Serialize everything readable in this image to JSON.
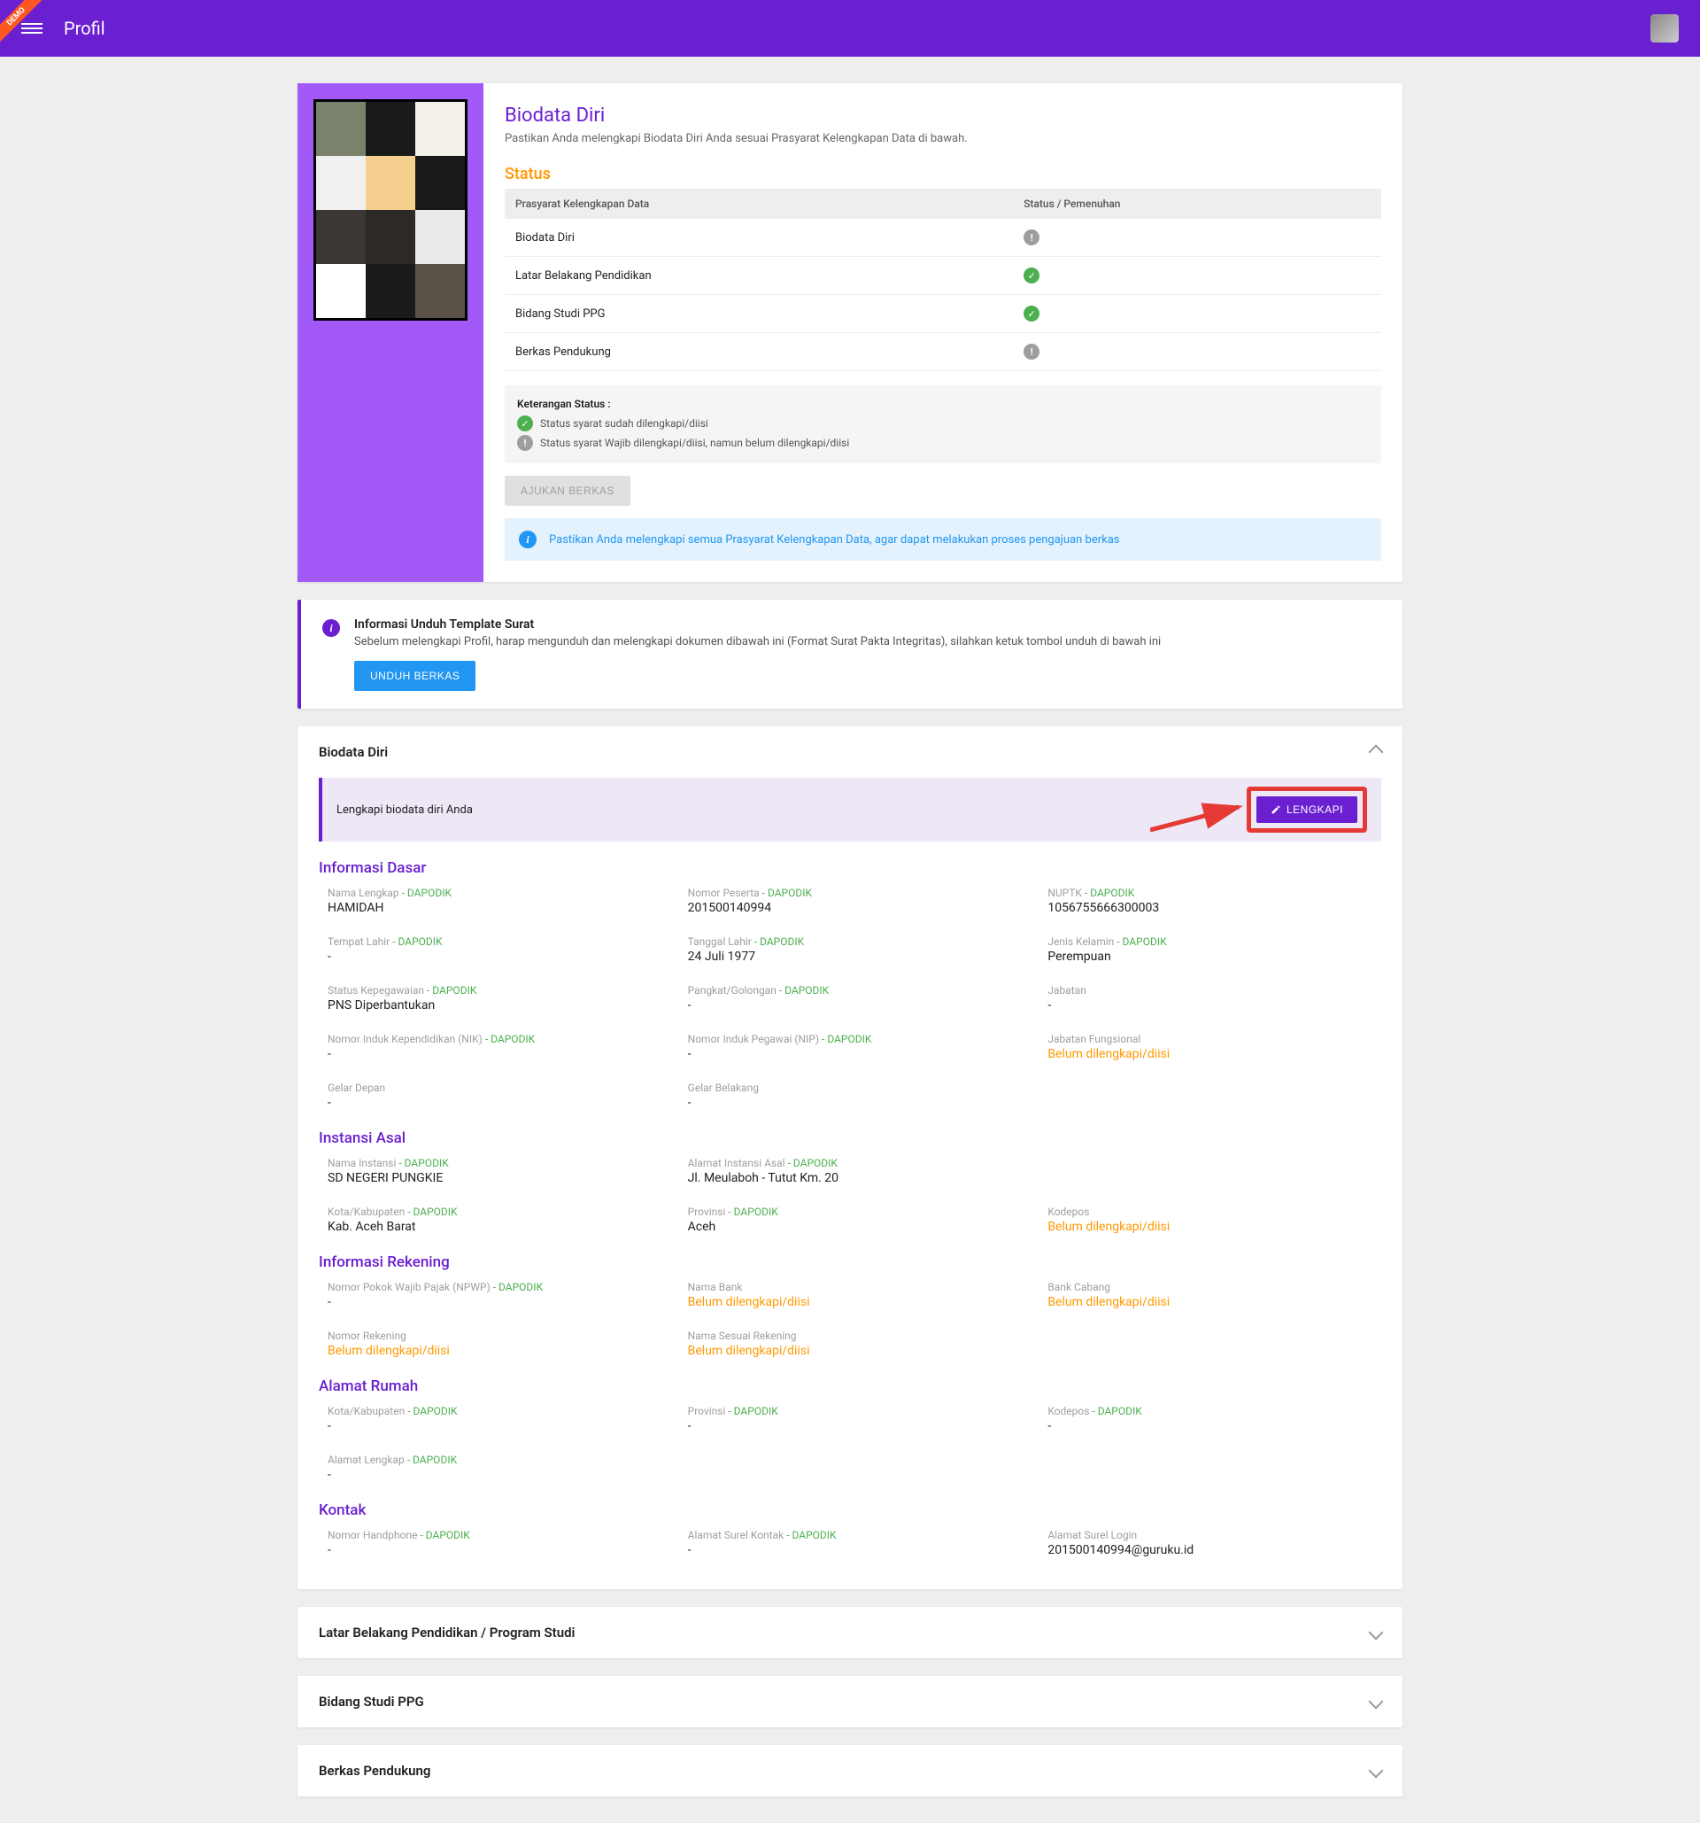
{
  "topbar": {
    "title": "Profil",
    "demo": "DEMO"
  },
  "biodata": {
    "title": "Biodata Diri",
    "subtitle": "Pastikan Anda melengkapi Biodata Diri Anda sesuai Prasyarat Kelengkapan Data di bawah."
  },
  "status": {
    "title": "Status",
    "col1": "Prasyarat Kelengkapan Data",
    "col2": "Status / Pemenuhan",
    "rows": [
      {
        "label": "Biodata Diri",
        "ok": false
      },
      {
        "label": "Latar Belakang Pendidikan",
        "ok": true
      },
      {
        "label": "Bidang Studi PPG",
        "ok": true
      },
      {
        "label": "Berkas Pendukung",
        "ok": false
      }
    ],
    "keterangan_title": "Keterangan Status :",
    "keterangan_ok": "Status syarat sudah dilengkapi/diisi",
    "keterangan_pending": "Status syarat Wajib dilengkapi/diisi, namun belum dilengkapi/diisi",
    "ajukan": "AJUKAN BERKAS",
    "banner": "Pastikan Anda melengkapi semua Prasyarat Kelengkapan Data, agar dapat melakukan proses pengajuan berkas"
  },
  "template": {
    "title": "Informasi Unduh Template Surat",
    "desc": "Sebelum melengkapi Profil, harap mengunduh dan melengkapi dokumen dibawah ini (Format Surat Pakta Integritas), silahkan ketuk tombol unduh di bawah ini",
    "button": "UNDUH BERKAS"
  },
  "panels": {
    "biodata": "Biodata Diri",
    "latar": "Latar Belakang Pendidikan / Program Studi",
    "bidang": "Bidang Studi PPG",
    "berkas": "Berkas Pendukung"
  },
  "lengkapi": {
    "text": "Lengkapi biodata diri Anda",
    "button": "LENGKAPI"
  },
  "dapodik_tag": " - DAPODIK",
  "belum": "Belum dilengkapi/diisi",
  "dasar": {
    "title": "Informasi Dasar",
    "nama_l": "Nama Lengkap",
    "nama_v": "HAMIDAH",
    "nopes_l": "Nomor Peserta",
    "nopes_v": "201500140994",
    "nuptk_l": "NUPTK",
    "nuptk_v": "1056755666300003",
    "tlahir_l": "Tempat Lahir",
    "tlahir_v": "-",
    "tgl_l": "Tanggal Lahir",
    "tgl_v": "24 Juli 1977",
    "jk_l": "Jenis Kelamin",
    "jk_v": "Perempuan",
    "statkep_l": "Status Kepegawaian",
    "statkep_v": "PNS Diperbantukan",
    "pangkat_l": "Pangkat/Golongan",
    "pangkat_v": "-",
    "jabatan_l": "Jabatan",
    "jabatan_v": "-",
    "nik_l": "Nomor Induk Kependidikan (NIK)",
    "nik_v": "-",
    "nip_l": "Nomor Induk Pegawai (NIP)",
    "nip_v": "-",
    "jabfung_l": "Jabatan Fungsional",
    "gelard_l": "Gelar Depan",
    "gelard_v": "-",
    "gelarb_l": "Gelar Belakang",
    "gelarb_v": "-"
  },
  "instansi": {
    "title": "Instansi Asal",
    "nama_l": "Nama Instansi",
    "nama_v": "SD NEGERI PUNGKIE",
    "alamat_l": "Alamat Instansi Asal",
    "alamat_v": "Jl. Meulaboh - Tutut Km. 20",
    "kota_l": "Kota/Kabupaten",
    "kota_v": "Kab. Aceh Barat",
    "prov_l": "Provinsi",
    "prov_v": "Aceh",
    "kodepos_l": "Kodepos"
  },
  "rekening": {
    "title": "Informasi Rekening",
    "npwp_l": "Nomor Pokok Wajib Pajak (NPWP)",
    "npwp_v": "-",
    "bank_l": "Nama Bank",
    "cabang_l": "Bank Cabang",
    "norek_l": "Nomor Rekening",
    "sesuai_l": "Nama Sesuai Rekening"
  },
  "rumah": {
    "title": "Alamat Rumah",
    "kota_l": "Kota/Kabupaten",
    "kota_v": "-",
    "prov_l": "Provinsi",
    "prov_v": "-",
    "kodepos_l": "Kodepos",
    "kodepos_v": "-",
    "alamat_l": "Alamat Lengkap",
    "alamat_v": "-"
  },
  "kontak": {
    "title": "Kontak",
    "hp_l": "Nomor Handphone",
    "hp_v": "-",
    "email_l": "Alamat Surel Kontak",
    "email_v": "-",
    "login_l": "Alamat Surel Login",
    "login_v": "201500140994@guruku.id"
  }
}
